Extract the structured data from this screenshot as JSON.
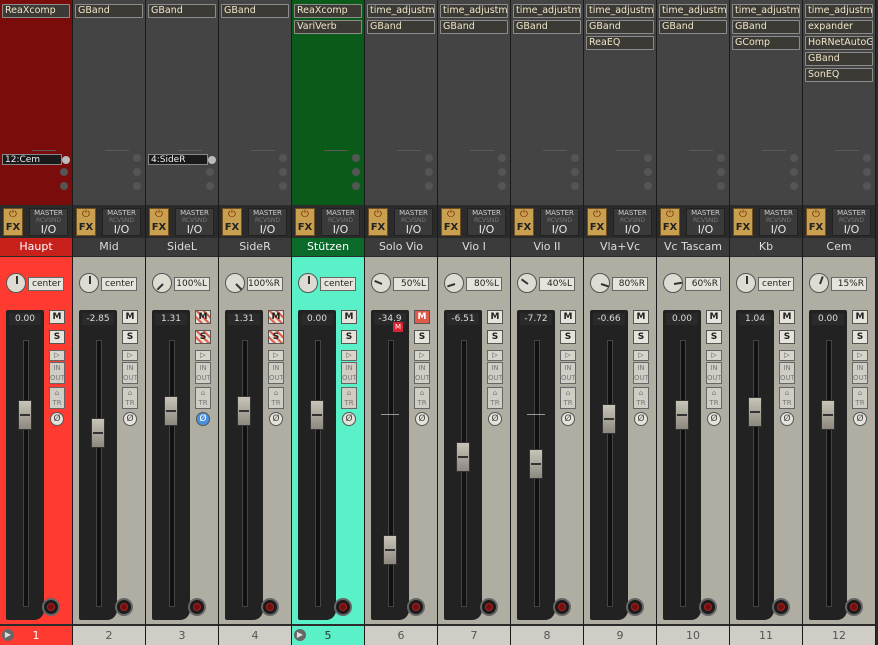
{
  "tracks": [
    {
      "name": "Haupt",
      "number": "1",
      "fx": [
        "ReaXcomp"
      ],
      "send": "12:Cem",
      "pan": "center",
      "volume": "0.00",
      "fader_db": 0,
      "color": "#ff3a30",
      "header_color": "#7a0c0c",
      "mute": "M",
      "solo": "S",
      "phase_style": "normal",
      "output_mode": "MASTER"
    },
    {
      "name": "Mid",
      "number": "2",
      "fx": [
        "GBand"
      ],
      "send": "",
      "pan": "center",
      "volume": "-2.85",
      "fader_db": -2.85,
      "color": "",
      "header_color": "",
      "mute": "M",
      "solo": "S",
      "phase_style": "normal",
      "output_mode": "MASTER"
    },
    {
      "name": "SideL",
      "number": "3",
      "fx": [
        "GBand"
      ],
      "send": "4:SideR",
      "pan": "100%L",
      "volume": "1.31",
      "fader_db": 1.31,
      "color": "",
      "header_color": "",
      "mute": "M",
      "solo": "S",
      "phase_style": "blue",
      "output_mode": "MASTER"
    },
    {
      "name": "SideR",
      "number": "4",
      "fx": [
        "GBand"
      ],
      "send": "",
      "pan": "100%R",
      "volume": "1.31",
      "fader_db": 1.31,
      "color": "",
      "header_color": "",
      "mute": "M",
      "solo": "S",
      "phase_style": "normal",
      "output_mode": "MASTER"
    },
    {
      "name": "Stützen",
      "number": "5",
      "fx": [
        "ReaXcomp",
        "VariVerb"
      ],
      "send": "",
      "pan": "center",
      "volume": "0.00",
      "fader_db": 0,
      "color": "#5af0c8",
      "header_color": "#0a5a1a",
      "mute": "M",
      "solo": "S",
      "phase_style": "normal",
      "output_mode": "MASTER"
    },
    {
      "name": "Solo Vio",
      "number": "6",
      "fx": [
        "time_adjustmen",
        "GBand"
      ],
      "send": "",
      "pan": "50%L",
      "volume": "-34.9",
      "fader_db": -34.9,
      "color": "",
      "header_color": "",
      "mute": "M",
      "solo": "S",
      "phase_style": "normal",
      "output_mode": "MASTER"
    },
    {
      "name": "Vio I",
      "number": "7",
      "fx": [
        "time_adjustmen",
        "GBand"
      ],
      "send": "",
      "pan": "80%L",
      "volume": "-6.51",
      "fader_db": -6.51,
      "color": "",
      "header_color": "",
      "mute": "M",
      "solo": "S",
      "phase_style": "normal",
      "output_mode": "MASTER"
    },
    {
      "name": "Vio II",
      "number": "8",
      "fx": [
        "time_adjustmen",
        "GBand"
      ],
      "send": "",
      "pan": "40%L",
      "volume": "-7.72",
      "fader_db": -7.72,
      "color": "",
      "header_color": "",
      "mute": "M",
      "solo": "S",
      "phase_style": "normal",
      "output_mode": "MASTER"
    },
    {
      "name": "Vla+Vc",
      "number": "9",
      "fx": [
        "time_adjustmen",
        "GBand",
        "ReaEQ"
      ],
      "send": "",
      "pan": "80%R",
      "volume": "-0.66",
      "fader_db": -0.66,
      "color": "",
      "header_color": "",
      "mute": "M",
      "solo": "S",
      "phase_style": "normal",
      "output_mode": "MASTER"
    },
    {
      "name": "Vc Tascam",
      "number": "10",
      "fx": [
        "time_adjustmen",
        "GBand"
      ],
      "send": "",
      "pan": "60%R",
      "volume": "0.00",
      "fader_db": 0,
      "color": "",
      "header_color": "",
      "mute": "M",
      "solo": "S",
      "phase_style": "normal",
      "output_mode": "MASTER"
    },
    {
      "name": "Kb",
      "number": "11",
      "fx": [
        "time_adjustmen",
        "GBand",
        "GComp"
      ],
      "send": "",
      "pan": "center",
      "volume": "1.04",
      "fader_db": 1.04,
      "color": "",
      "header_color": "",
      "mute": "M",
      "solo": "S",
      "phase_style": "normal",
      "output_mode": "MASTER"
    },
    {
      "name": "Cem",
      "number": "12",
      "fx": [
        "time_adjustmen",
        "expander",
        "HoRNetAutoGai",
        "GBand",
        "SonEQ"
      ],
      "send": "",
      "pan": "15%R",
      "volume": "0.00",
      "fader_db": 0,
      "color": "",
      "header_color": "",
      "mute": "M",
      "solo": "S",
      "phase_style": "normal",
      "output_mode": "MASTER"
    }
  ],
  "labels": {
    "fx": "FX",
    "io": "I/O",
    "master": "MASTER",
    "rcv": "RCV",
    "snd": "SND",
    "in": "IN",
    "out": "OUT",
    "tr": "TR",
    "record_mark": "M"
  },
  "colors": {
    "accent_fx": "#c8a050",
    "strip_body": "#b0ada2",
    "dark": "#2b2b2b",
    "selected_red": "#ff3a30",
    "selected_teal": "#5af0c8"
  }
}
